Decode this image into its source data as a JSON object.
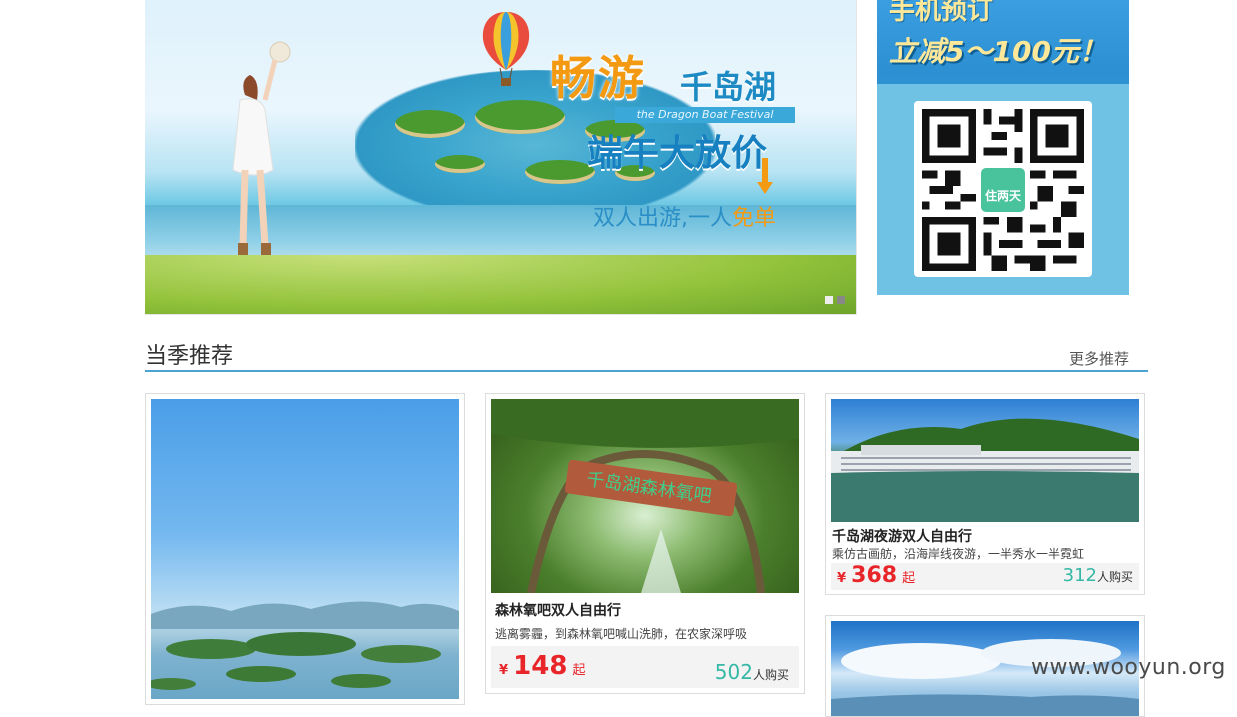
{
  "banner": {
    "headline_1": "畅游",
    "headline_1b": "千岛湖",
    "english_tag": "the Dragon Boat Festival",
    "headline_2": "端午大放价",
    "sub_1": "双人出游,一人",
    "sub_2": "免单",
    "slides": 2,
    "active_slide": 2
  },
  "mobile_panel": {
    "title": "手机预订",
    "promo": "立减5～100元！",
    "qr_logo_text": "住两天"
  },
  "section": {
    "title": "当季推荐",
    "more_link": "更多推荐"
  },
  "cards": [
    {
      "name": "",
      "image": "lake-islands-photo"
    },
    {
      "name": "森林氧吧双人自由行",
      "desc": "逃离雾霾，到森林氧吧喊山洗肺，在农家深呼吸",
      "currency": "¥",
      "price": "148",
      "price_suffix": "起",
      "bought_count": "502",
      "bought_label": "人购买",
      "image": "forest-gate-photo"
    },
    {
      "name": "千岛湖夜游双人自由行",
      "desc": "乘仿古画舫，沿海岸线夜游，一半秀水一半霓虹",
      "currency": "¥",
      "price": "368",
      "price_suffix": "起",
      "bought_count": "312",
      "bought_label": "人购买",
      "image": "lakeside-hotel-photo"
    },
    {
      "name": "",
      "image": "sky-lake-photo"
    }
  ],
  "watermark": "www.wooyun.org",
  "colors": {
    "accent_line": "#4aa3d3",
    "price_red": "#e8262a",
    "bought_teal": "#35b8a5",
    "banner_orange": "#f39a12",
    "banner_blue": "#1780c0"
  }
}
